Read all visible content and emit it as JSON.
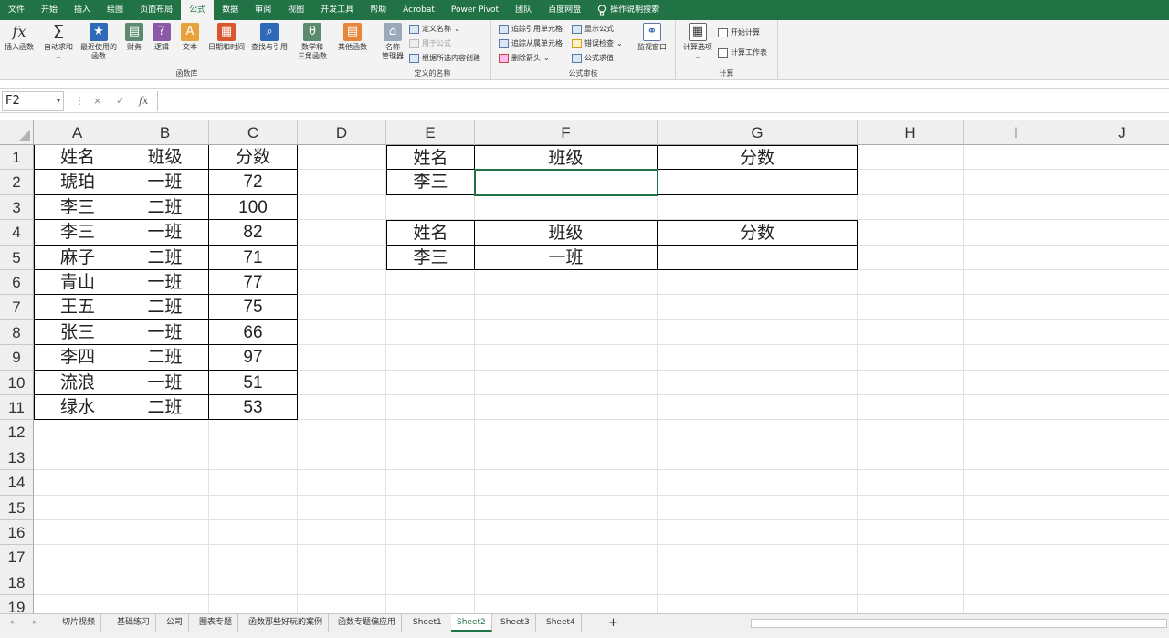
{
  "menu": [
    "文件",
    "开始",
    "插入",
    "绘图",
    "页面布局",
    "公式",
    "数据",
    "审阅",
    "视图",
    "开发工具",
    "帮助",
    "Acrobat",
    "Power Pivot",
    "团队",
    "百度网盘"
  ],
  "menu_active": "公式",
  "tell_me": "操作说明搜索",
  "ribbon": {
    "function_library": {
      "insert_function": "插入函数",
      "autosum": "自动求和",
      "recent_1": "最近使用的",
      "recent_2": "函数",
      "financial": "财务",
      "logical": "逻辑",
      "text": "文本",
      "datetime": "日期和时间",
      "lookup": "查找与引用",
      "math_1": "数学和",
      "math_2": "三角函数",
      "more": "其他函数",
      "label": "函数库"
    },
    "defined_names": {
      "name_manager_1": "名称",
      "name_manager_2": "管理器",
      "define_name": "定义名称",
      "use_in_formula": "用于公式",
      "create_from_selection": "根据所选内容创建",
      "label": "定义的名称"
    },
    "formula_auditing": {
      "trace_precedents": "追踪引用单元格",
      "trace_dependents": "追踪从属单元格",
      "remove_arrows": "删除箭头",
      "show_formulas": "显示公式",
      "error_checking": "错误检查",
      "evaluate": "公式求值",
      "watch_window": "监视窗口",
      "label": "公式审核"
    },
    "calculation": {
      "options": "计算选项",
      "calc_now": "开始计算",
      "calc_sheet": "计算工作表",
      "label": "计算"
    }
  },
  "formula_bar": {
    "name_box": "F2",
    "cancel": "×",
    "enter": "✓",
    "fx": "fx",
    "content": ""
  },
  "columns": [
    "A",
    "B",
    "C",
    "D",
    "E",
    "F",
    "G",
    "H",
    "I",
    "J"
  ],
  "rows": [
    "1",
    "2",
    "3",
    "4",
    "5",
    "6",
    "7",
    "8",
    "9",
    "10",
    "11",
    "12",
    "13",
    "14",
    "15",
    "16",
    "17",
    "18",
    "19"
  ],
  "table_main": {
    "headers": [
      "姓名",
      "班级",
      "分数"
    ],
    "rows": [
      [
        "琥珀",
        "一班",
        "72"
      ],
      [
        "李三",
        "二班",
        "100"
      ],
      [
        "李三",
        "一班",
        "82"
      ],
      [
        "麻子",
        "二班",
        "71"
      ],
      [
        "青山",
        "一班",
        "77"
      ],
      [
        "王五",
        "二班",
        "75"
      ],
      [
        "张三",
        "一班",
        "66"
      ],
      [
        "李四",
        "二班",
        "97"
      ],
      [
        "流浪",
        "一班",
        "51"
      ],
      [
        "绿水",
        "二班",
        "53"
      ]
    ]
  },
  "lookup1": {
    "headers": [
      "姓名",
      "班级",
      "分数"
    ],
    "values": [
      "李三",
      "",
      ""
    ]
  },
  "lookup2": {
    "headers": [
      "姓名",
      "班级",
      "分数"
    ],
    "values": [
      "李三",
      "一班",
      ""
    ]
  },
  "sheet_tabs": [
    "切片视频",
    "基础练习",
    "公司",
    "图表专题",
    "函数那些好玩的案例",
    "函数专题偏应用",
    "Sheet1",
    "Sheet2",
    "Sheet3",
    "Sheet4"
  ],
  "active_sheet": "Sheet2",
  "add_sheet": "+",
  "colors": {
    "accent": "#217346"
  }
}
